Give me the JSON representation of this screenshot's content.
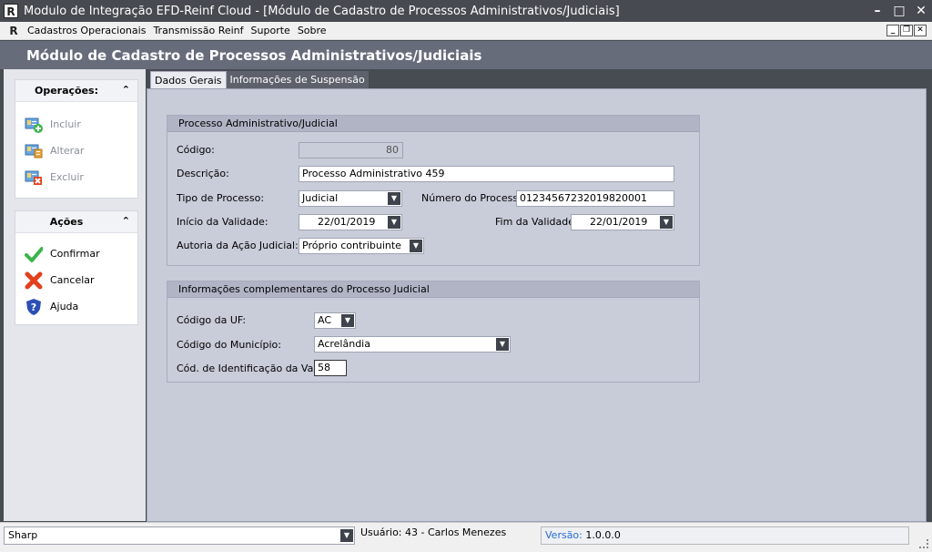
{
  "window": {
    "title": "Modulo de Integração EFD-Reinf Cloud - [Módulo de Cadastro de Processos Administrativos/Judiciais]",
    "icon_letter": "R"
  },
  "menubar": {
    "icon_letter": "R",
    "items": [
      "Cadastros Operacionais",
      "Transmissão Reinf",
      "Suporte",
      "Sobre"
    ]
  },
  "header": {
    "title": "Módulo de Cadastro de Processos Administrativos/Judiciais"
  },
  "operacoes": {
    "title": "Operações:",
    "items": [
      {
        "label": "Incluir",
        "icon": "add-record-icon"
      },
      {
        "label": "Alterar",
        "icon": "edit-record-icon"
      },
      {
        "label": "Excluir",
        "icon": "delete-record-icon"
      }
    ]
  },
  "acoes": {
    "title": "Ações",
    "items": [
      {
        "label": "Confirmar",
        "icon": "check-icon",
        "color": "#3bb54a"
      },
      {
        "label": "Cancelar",
        "icon": "x-icon",
        "color": "#e2401c"
      },
      {
        "label": "Ajuda",
        "icon": "help-shield-icon",
        "color": "#2b4fb5"
      }
    ]
  },
  "tabs": [
    "Dados Gerais",
    "Informações de Suspensão"
  ],
  "processo": {
    "section_title": "Processo Administrativo/Judicial",
    "codigo_label": "Código:",
    "codigo_value": "80",
    "descricao_label": "Descrição:",
    "descricao_value": "Processo Administrativo 459",
    "tipo_label": "Tipo de Processo:",
    "tipo_value": "Judicial",
    "numero_label": "Número do Processo:",
    "numero_value": "01234567232019820001",
    "inicio_label": "Início da Validade:",
    "inicio_value": "22/01/2019",
    "fim_label": "Fim da Validade:",
    "fim_value": "22/01/2019",
    "autoria_label": "Autoria da Ação Judicial:",
    "autoria_value": "Próprio contribuinte"
  },
  "complementares": {
    "section_title": "Informações complementares do Processo Judicial",
    "uf_label": "Código da UF:",
    "uf_value": "AC",
    "municipio_label": "Código do Município:",
    "municipio_value": "Acrelândia",
    "vara_label": "Cód. de Identificação da Vara:",
    "vara_value": "58"
  },
  "statusbar": {
    "theme_value": "Sharp",
    "user_text": "Usuário: 43 - Carlos Menezes",
    "version_label": "Versão:",
    "version_value": "1.0.0.0"
  }
}
